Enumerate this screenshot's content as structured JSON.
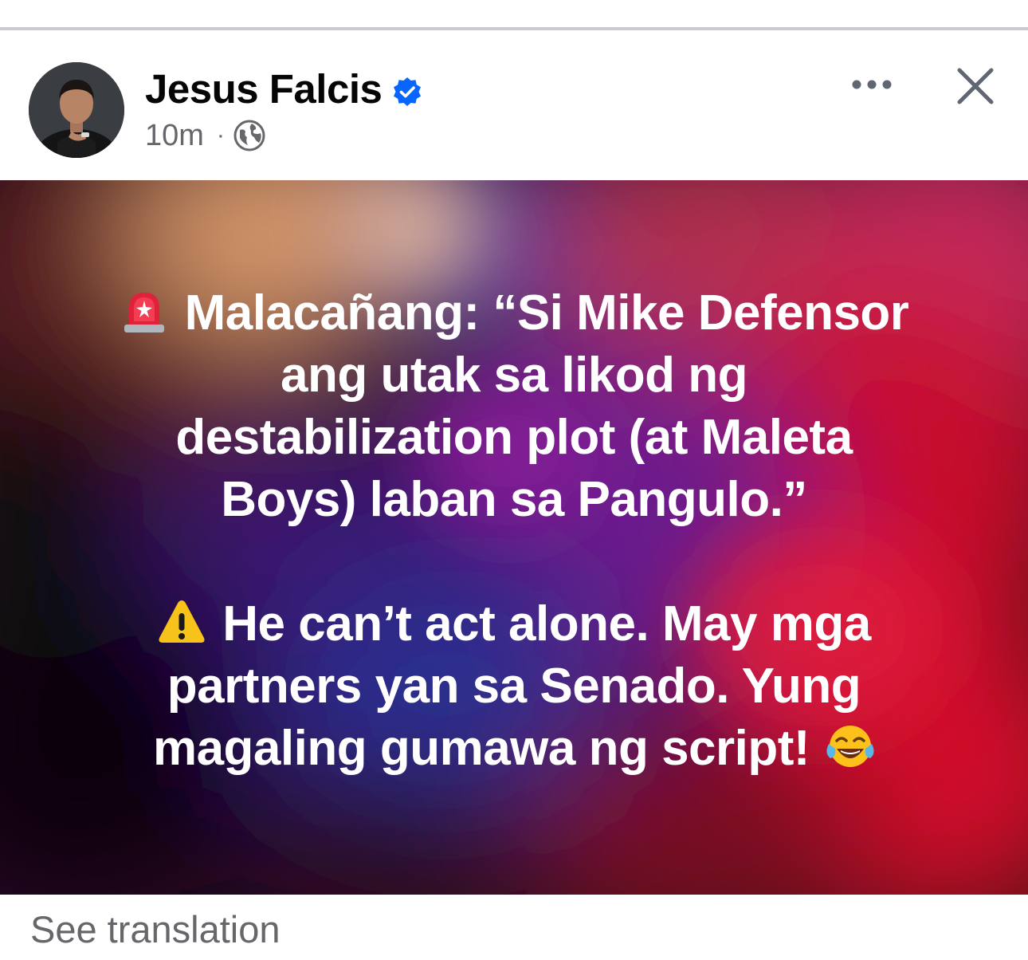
{
  "post": {
    "author_name": "Jesus Falcis",
    "verified_icon": "verified-badge-icon",
    "timestamp": "10m",
    "separator": "·",
    "audience_icon": "globe-icon",
    "more_icon": "more-options-icon",
    "close_icon": "close-icon"
  },
  "text_post": {
    "background_colors": [
      "#0d070c",
      "#c1122a",
      "#5a1a8c",
      "#2a2f8f",
      "#e9a06a"
    ],
    "text_color": "#ffffff",
    "paragraph_1": {
      "emoji": "rotating-light-icon",
      "lines": [
        "Malacañang: “Si Mike Defensor",
        "ang utak sa likod ng",
        "destabilization plot (at Maleta",
        "Boys) laban sa Pangulo.”"
      ]
    },
    "paragraph_2": {
      "emoji": "warning-icon",
      "lines": [
        "He can’t act alone. May mga",
        "partners yan sa Senado. Yung",
        "magaling gumawa ng script!"
      ],
      "trailing_emoji": "face-with-tears-of-joy-icon"
    }
  },
  "footer": {
    "see_translation": "See translation"
  },
  "colors": {
    "name": "#050505",
    "meta": "#65676b",
    "verified": "#0866ff",
    "divider": "#c9ccd1"
  }
}
